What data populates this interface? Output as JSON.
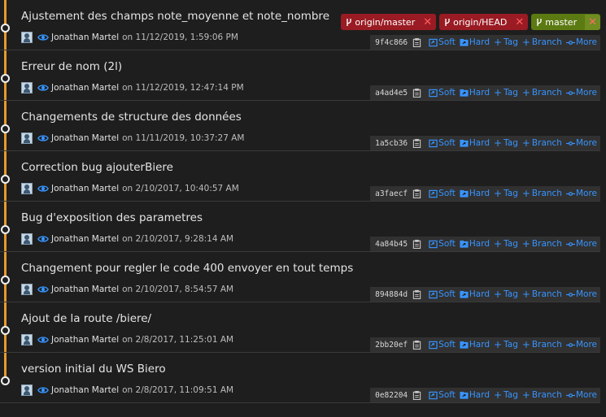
{
  "branches": [
    {
      "name": "origin/master",
      "color": "#9a1b23"
    },
    {
      "name": "origin/HEAD",
      "color": "#9a1b23"
    },
    {
      "name": "master",
      "color": "#5c7a12"
    }
  ],
  "actions": {
    "soft": "Soft",
    "hard": "Hard",
    "tag": "Tag",
    "branch": "Branch",
    "more": "More"
  },
  "commits": [
    {
      "message": "Ajustement des champs note_moyenne et note_nombre",
      "author": "Jonathan Martel",
      "date": "on 11/12/2019, 1:59:06 PM",
      "hash": "9f4c866"
    },
    {
      "message": "Erreur de nom (2l)",
      "author": "Jonathan Martel",
      "date": "on 11/12/2019, 12:47:14 PM",
      "hash": "a4ad4e5"
    },
    {
      "message": "Changements de structure des données",
      "author": "Jonathan Martel",
      "date": "on 11/11/2019, 10:37:27 AM",
      "hash": "1a5cb36"
    },
    {
      "message": "Correction bug ajouterBiere",
      "author": "Jonathan Martel",
      "date": "on 2/10/2017, 10:40:57 AM",
      "hash": "a3faecf"
    },
    {
      "message": "Bug d'exposition des parametres",
      "author": "Jonathan Martel",
      "date": "on 2/10/2017, 9:28:14 AM",
      "hash": "4a84b45"
    },
    {
      "message": "Changement pour regler le code 400 envoyer en tout temps",
      "author": "Jonathan Martel",
      "date": "on 2/10/2017, 8:54:57 AM",
      "hash": "894884d"
    },
    {
      "message": "Ajout de la route /biere/",
      "author": "Jonathan Martel",
      "date": "on 2/8/2017, 11:25:01 AM",
      "hash": "2bb20ef"
    },
    {
      "message": "version initial du WS Biero",
      "author": "Jonathan Martel",
      "date": "on 2/8/2017, 11:09:51 AM",
      "hash": "0e82204"
    }
  ]
}
